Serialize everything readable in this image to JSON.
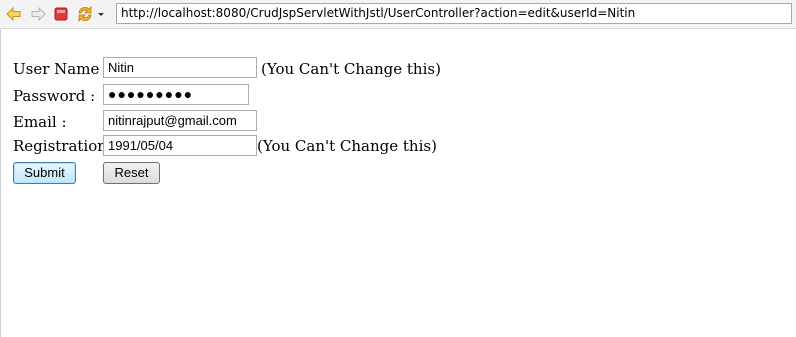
{
  "browser": {
    "url": "http://localhost:8080/CrudJspServletWithJstl/UserController?action=edit&userId=Nitin"
  },
  "form": {
    "username_label": "User Name :",
    "username_value": "Nitin",
    "username_note": "(You Can't Change this)",
    "password_label": "Password :",
    "password_value": "●●●●●●●●●",
    "email_label": "Email :",
    "email_value": "nitinrajput@gmail.com",
    "registration_label": "Registration :",
    "registration_value": "1991/05/04",
    "registration_note": "(You Can't Change this)",
    "submit_label": "Submit",
    "reset_label": "Reset"
  }
}
